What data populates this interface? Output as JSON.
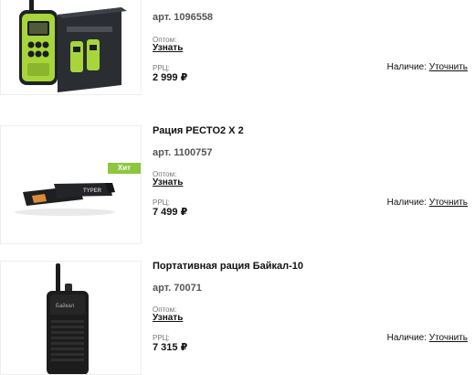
{
  "products": [
    {
      "title": "",
      "article": "арт. 1096558",
      "wholesale_label": "Оптом:",
      "wholesale_link": "Узнать",
      "rrp_label": "РРЦ:",
      "price": "2 999 ₽",
      "availability_label": "Наличие:",
      "availability_link": "Уточнить",
      "image_icon": "green-walkie-talkie-package-image"
    },
    {
      "title": "Рация PECTO2 X 2",
      "article": "арт. 1100757",
      "wholesale_label": "Оптом:",
      "wholesale_link": "Узнать",
      "rrp_label": "РРЦ:",
      "price": "7 499 ₽",
      "availability_label": "Наличие:",
      "availability_link": "Уточнить",
      "badge": "Хит",
      "image_icon": "compact-radio-pair-image"
    },
    {
      "title": "Портативная рация Байкал-10",
      "article": "арт. 70071",
      "wholesale_label": "Оптом:",
      "wholesale_link": "Узнать",
      "rrp_label": "РРЦ:",
      "price": "7 315 ₽",
      "availability_label": "Наличие:",
      "availability_link": "Уточнить",
      "image_icon": "black-portable-radio-image"
    }
  ],
  "colors": {
    "badge_green": "#8dc63f",
    "lime_radio": "#a6d63a"
  }
}
